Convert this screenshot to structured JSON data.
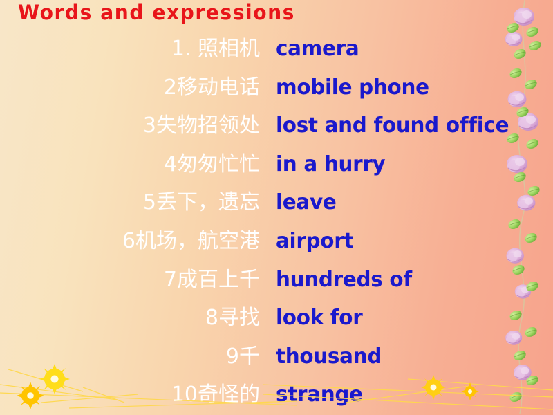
{
  "slide": {
    "title": "Words  and  expressions",
    "background": {
      "gradient_from": "#f8e6c8",
      "gradient_to": "#f7a38c"
    },
    "colors": {
      "title": "#e8151a",
      "chinese": "#ffffff",
      "english": "#1a19cc",
      "rose": "#d9a6d2",
      "leaf": "#8cc65a",
      "yellow_flower": "#ffd21a"
    }
  },
  "vocabulary": {
    "rows": [
      {
        "chinese": "1. 照相机",
        "english": "camera"
      },
      {
        "chinese": "2移动电话",
        "english": "mobile phone"
      },
      {
        "chinese": "3失物招领处",
        "english": "lost and found office"
      },
      {
        "chinese": "4匆匆忙忙",
        "english": "in a hurry"
      },
      {
        "chinese": "5丢下，遗忘",
        "english": "leave"
      },
      {
        "chinese": "6机场，航空港",
        "english": "airport"
      },
      {
        "chinese": "7成百上千",
        "english": "hundreds of"
      },
      {
        "chinese": "8寻找",
        "english": "look for"
      },
      {
        "chinese": "9千",
        "english": "thousand"
      },
      {
        "chinese": "10奇怪的",
        "english": "strange"
      }
    ]
  },
  "decorations": {
    "rose_vine": "rose-vine-border",
    "bottom_flowers_left": "yellow-flower-spray",
    "bottom_flowers_right": "yellow-flower-spray"
  }
}
